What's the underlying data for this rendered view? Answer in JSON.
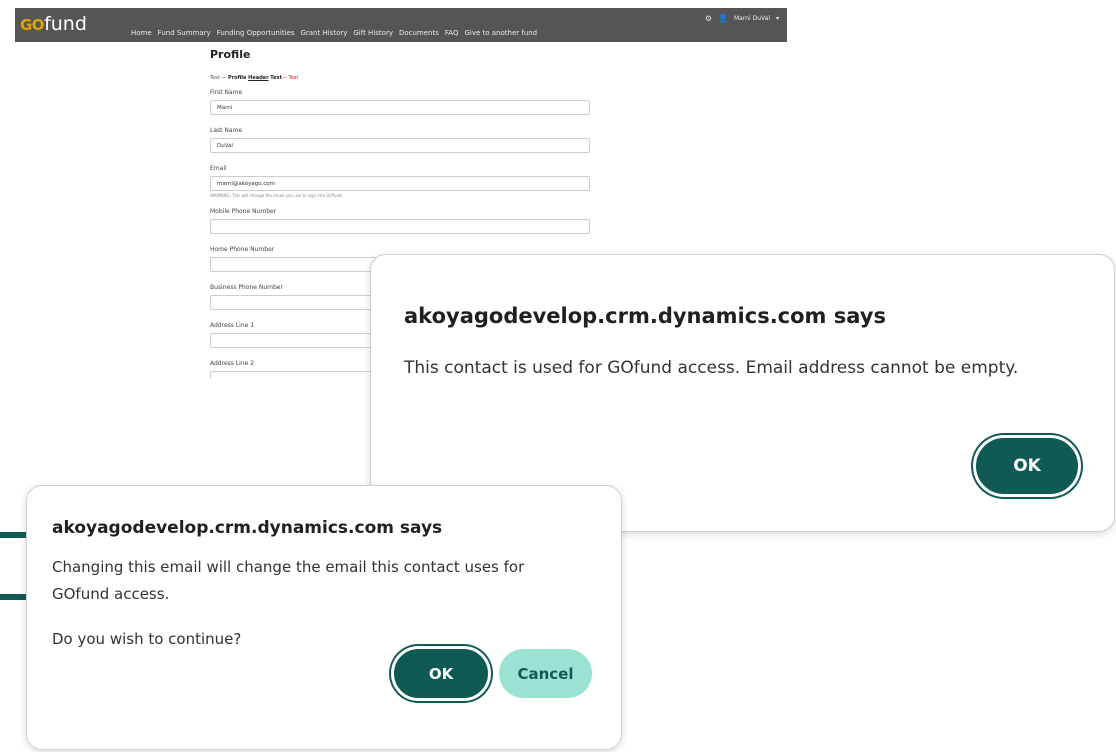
{
  "app": {
    "logo_go": "GO",
    "logo_fund": "fund",
    "nav": [
      "Home",
      "Fund Summary",
      "Funding Opportunities",
      "Grant History",
      "Gift History",
      "Documents",
      "FAQ",
      "Give to another fund"
    ],
    "user_name": "Marni DuVal"
  },
  "profile": {
    "title": "Profile",
    "header_prefix": "Test — ",
    "header_bold_1": "Profile ",
    "header_underline": "Header",
    "header_bold_2": " Text",
    "header_suffix": "— Test",
    "first_name_label": "First Name",
    "first_name_value": "Marni",
    "last_name_label": "Last Name",
    "last_name_value": "DuVal",
    "email_label": "Email",
    "email_value": "marni@akoyago.com",
    "email_warning": "WARNING: This will change the email you use to sign into GOfund.",
    "mobile_label": "Mobile Phone Number",
    "home_label": "Home Phone Number",
    "business_label": "Business Phone Number",
    "address1_label": "Address Line 1",
    "address2_label": "Address Line 2"
  },
  "dialog_empty": {
    "title": "akoyagodevelop.crm.dynamics.com says",
    "message": "This contact is used for GOfund access.  Email address cannot be empty.",
    "ok_label": "OK"
  },
  "dialog_change": {
    "title": "akoyagodevelop.crm.dynamics.com says",
    "message_1": "Changing this email will change the email this contact uses for GOfund access.",
    "message_2": "Do you wish to continue?",
    "ok_label": "OK",
    "cancel_label": "Cancel"
  },
  "colors": {
    "brand_teal": "#105a55",
    "cancel_fill": "#9ae3d3",
    "topbar": "#555555",
    "logo_gold": "#e0a400"
  }
}
